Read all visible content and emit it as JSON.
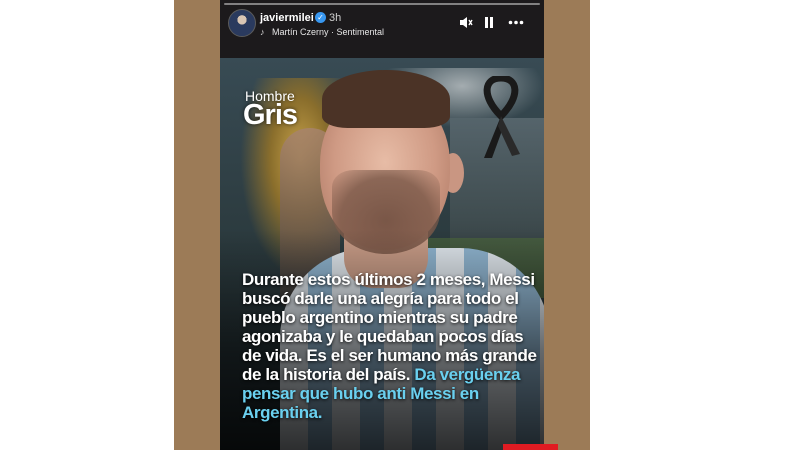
{
  "story": {
    "username": "javiermilei",
    "verified_mark": "✓",
    "time": "3h",
    "song": "Martín Czerny · Sentimental",
    "icons": {
      "mute": "speaker-muted-icon",
      "pause": "pause-icon",
      "more": "more-options-icon",
      "music": "music-note-icon"
    }
  },
  "post": {
    "brand_small": "Hombre",
    "brand_big": "Gris",
    "caption_main": "Durante estos últimos 2 meses, Messi buscó darle una alegría para todo el pueblo argentino mientras su padre agonizaba y le quedaban pocos días de vida. Es el ser humano más grande de la historia del país.",
    "caption_accent": "Da vergüenza pensar que hubo anti Messi en Argentina."
  },
  "colors": {
    "frame": "#9c7b57",
    "accent_text": "#6ad0ef",
    "verified": "#3897f0",
    "strip": "#e01b22"
  }
}
